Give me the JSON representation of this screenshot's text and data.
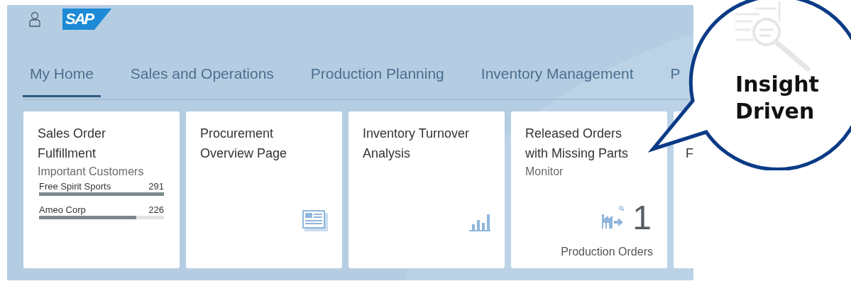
{
  "header": {
    "logo": "SAP"
  },
  "tabs": [
    {
      "label": "My Home",
      "selected": true
    },
    {
      "label": "Sales and Operations",
      "selected": false
    },
    {
      "label": "Production Planning",
      "selected": false
    },
    {
      "label": "Inventory Management",
      "selected": false
    },
    {
      "label": "P",
      "selected": false
    }
  ],
  "tiles": [
    {
      "kind": "list",
      "title": "Sales Order Fulfillment",
      "subtitle": "Important Customers",
      "items": [
        {
          "name": "Free Spirit Sports",
          "value": "291",
          "level": 1
        },
        {
          "name": "Ameo Corp",
          "value": "226",
          "level": 0.78
        }
      ]
    },
    {
      "kind": "page",
      "title": "Procurement Overview Page"
    },
    {
      "kind": "analysis",
      "title": "Inventory Turnover Analysis"
    },
    {
      "kind": "kpi",
      "title": "Released Orders with Missing Parts",
      "subtitle": "Monitor",
      "number": "1",
      "footer": "Production Orders"
    },
    {
      "kind": "partial",
      "title": "F"
    }
  ],
  "callout": {
    "text": "Insight Driven"
  }
}
